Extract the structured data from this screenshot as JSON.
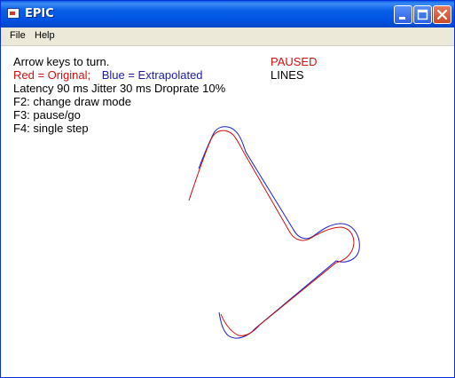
{
  "window": {
    "title": "EPIC",
    "colors": {
      "titlebar": "#0054e3",
      "original": "#cc1111",
      "extrapolated": "#1c1ca8"
    }
  },
  "menu": {
    "items": [
      "File",
      "Help"
    ]
  },
  "info": {
    "instructions": "Arrow keys to turn.",
    "legend_red": "Red = Original;",
    "legend_blue": "Blue = Extrapolated",
    "stats": "Latency 90 ms Jitter 30 ms Droprate 10%",
    "key_f2": "F2: change draw mode",
    "key_f3": "F3: pause/go",
    "key_f4": "F4: single step"
  },
  "status": {
    "state": "PAUSED",
    "draw_mode": "LINES"
  },
  "icons": [
    "app-icon",
    "minimize-icon",
    "maximize-icon",
    "close-icon"
  ]
}
